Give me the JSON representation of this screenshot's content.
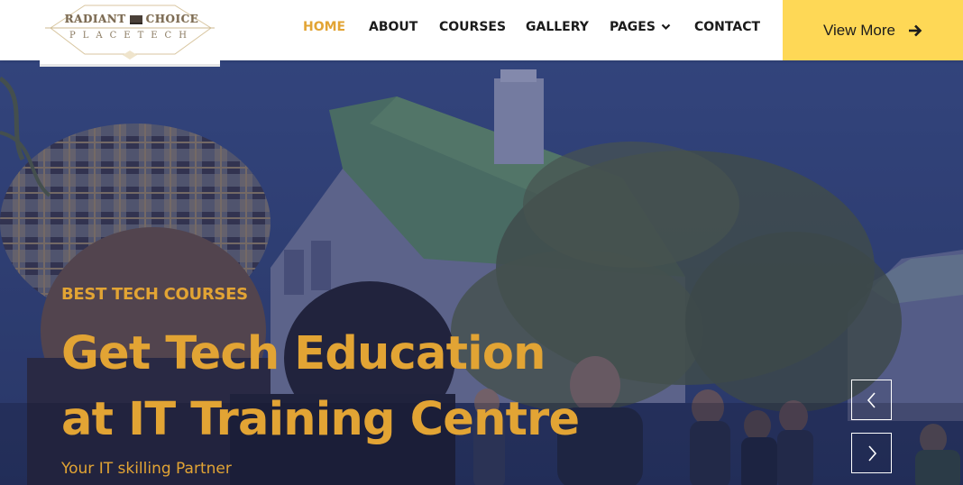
{
  "logo": {
    "line1_left": "RADIANT",
    "line1_right": "CHOICE",
    "line2": "PLACETECH",
    "icon": "laptop-icon"
  },
  "nav": {
    "items": [
      {
        "label": "HOME"
      },
      {
        "label": "ABOUT"
      },
      {
        "label": "COURSES"
      },
      {
        "label": "GALLERY"
      },
      {
        "label": "PAGES"
      },
      {
        "label": "CONTACT"
      }
    ],
    "pages_icon": "chevron-down-icon"
  },
  "cta": {
    "label": "View More",
    "icon": "arrow-right-icon"
  },
  "hero": {
    "eyebrow": "BEST TECH COURSES",
    "headline_line1": "Get Tech Education",
    "headline_line2": "at IT Training Centre",
    "tagline": "Your IT skilling Partner",
    "prev_icon": "chevron-left-icon",
    "next_icon": "chevron-right-icon"
  },
  "colors": {
    "accent": "#e2a434",
    "cta_bg": "#fed856",
    "nav_bg": "#ffffff",
    "nav_text": "#1b1b1b",
    "overlay": "#24306a"
  }
}
